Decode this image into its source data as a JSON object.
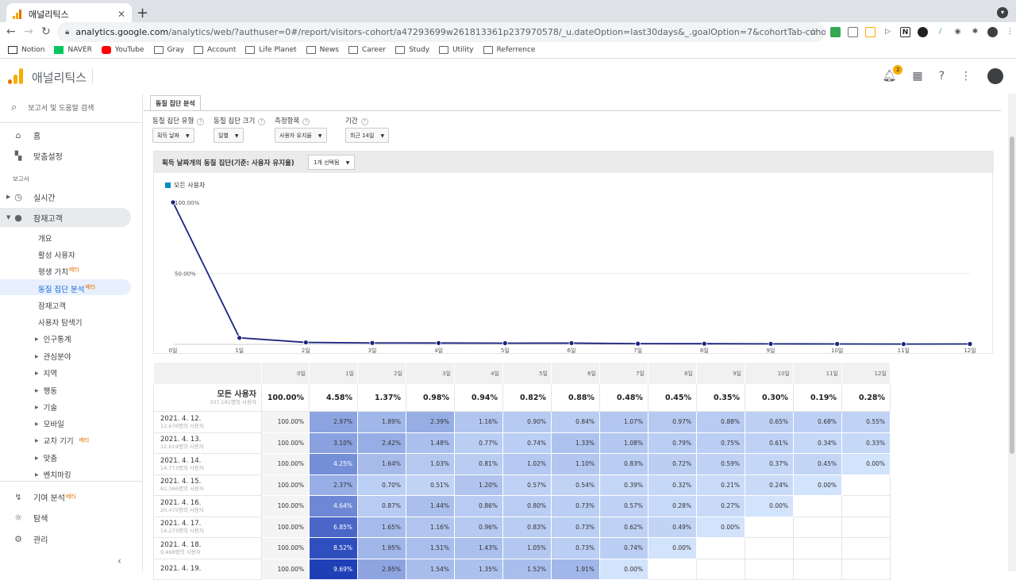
{
  "browser": {
    "tab_title": "애널리틱스",
    "tab_close": "✕",
    "url_host": "analytics.google.com",
    "url_path": "/analytics/web/?authuser=0#/report/visitors-cohort/a47293699w261813361p237970578/_u.dateOption=last30days&_.goalOption=7&cohortTab-cohortOption.cohortBaseDate=202104...",
    "bookmarks": [
      "Notion",
      "NAVER",
      "YouTube",
      "Gray",
      "Account",
      "Life Planet",
      "News",
      "Career",
      "Study",
      "Utility",
      "Referrence"
    ]
  },
  "header": {
    "title": "애널리틱스",
    "notification_count": "2"
  },
  "sidebar": {
    "search_placeholder": "보고서 및 도움말 검색",
    "home": "홈",
    "customization": "맞춤설정",
    "reports_label": "보고서",
    "realtime": "실시간",
    "audience": "잠재고객",
    "audience_sub": [
      "개요",
      "활성 사용자",
      "평생 가치",
      "동질 집단 분석",
      "잠재고객",
      "사용자 탐색기"
    ],
    "beta_label": "베타",
    "audience_groups": [
      "인구통계",
      "관심분야",
      "지역",
      "행동",
      "기술",
      "모바일",
      "교차 기기",
      "맞춤",
      "벤치마킹"
    ],
    "attribution": "기여 분석",
    "discover": "탐색",
    "admin": "관리",
    "collapse": "‹"
  },
  "report": {
    "tab": "동질 집단 분석",
    "filters": [
      {
        "label": "동질 집단 유형",
        "value": "획득 날짜"
      },
      {
        "label": "동질 집단 크기",
        "value": "일별"
      },
      {
        "label": "측정항목",
        "value": "사용자 유지율"
      },
      {
        "label": "기간",
        "value": "최근 14일"
      }
    ],
    "chart_header": "획득 날짜개의 동질 집단(기준: 사용자 유지율)",
    "chart_select": "1개 선택됨"
  },
  "chart_data": {
    "type": "line",
    "series": [
      {
        "name": "모든 사용자",
        "values": [
          100.0,
          4.58,
          1.37,
          0.98,
          0.94,
          0.82,
          0.88,
          0.48,
          0.45,
          0.35,
          0.3,
          0.19,
          0.28
        ]
      }
    ],
    "categories": [
      "0일",
      "1일",
      "2일",
      "3일",
      "4일",
      "5일",
      "6일",
      "7일",
      "8일",
      "9일",
      "10일",
      "11일",
      "12일"
    ],
    "y_ticks": [
      "100.00%",
      "50.00%"
    ],
    "ylim": [
      0,
      100
    ],
    "color": "#1a237e"
  },
  "table": {
    "columns": [
      "0일",
      "1일",
      "2일",
      "3일",
      "4일",
      "5일",
      "6일",
      "7일",
      "8일",
      "9일",
      "10일",
      "11일",
      "12일"
    ],
    "total": {
      "label": "모든 사용자",
      "sub": "337,181명의 사용자",
      "values": [
        "100.00%",
        "4.58%",
        "1.37%",
        "0.98%",
        "0.94%",
        "0.82%",
        "0.88%",
        "0.48%",
        "0.45%",
        "0.35%",
        "0.30%",
        "0.19%",
        "0.28%"
      ]
    },
    "rows": [
      {
        "date": "2021. 4. 12.",
        "sub": "12,676명의 사용자",
        "values": [
          "100.00%",
          "2.97%",
          "1.89%",
          "2.39%",
          "1.16%",
          "0.90%",
          "0.84%",
          "1.07%",
          "0.97%",
          "0.88%",
          "0.65%",
          "0.68%",
          "0.55%"
        ]
      },
      {
        "date": "2021. 4. 13.",
        "sub": "12,619명의 사용자",
        "values": [
          "100.00%",
          "3.10%",
          "2.42%",
          "1.48%",
          "0.77%",
          "0.74%",
          "1.33%",
          "1.08%",
          "0.79%",
          "0.75%",
          "0.61%",
          "0.34%",
          "0.33%"
        ]
      },
      {
        "date": "2021. 4. 14.",
        "sub": "14,773명의 사용자",
        "values": [
          "100.00%",
          "4.25%",
          "1.64%",
          "1.03%",
          "0.81%",
          "1.02%",
          "1.10%",
          "0.83%",
          "0.72%",
          "0.59%",
          "0.37%",
          "0.45%",
          "0.00%"
        ]
      },
      {
        "date": "2021. 4. 15.",
        "sub": "62,366명의 사용자",
        "values": [
          "100.00%",
          "2.37%",
          "0.70%",
          "0.51%",
          "1.20%",
          "0.57%",
          "0.54%",
          "0.39%",
          "0.32%",
          "0.21%",
          "0.24%",
          "0.00%",
          ""
        ]
      },
      {
        "date": "2021. 4. 16.",
        "sub": "20,475명의 사용자",
        "values": [
          "100.00%",
          "4.64%",
          "0.87%",
          "1.44%",
          "0.86%",
          "0.80%",
          "0.73%",
          "0.57%",
          "0.28%",
          "0.27%",
          "0.00%",
          "",
          ""
        ]
      },
      {
        "date": "2021. 4. 17.",
        "sub": "14,273명의 사용자",
        "values": [
          "100.00%",
          "6.85%",
          "1.65%",
          "1.16%",
          "0.96%",
          "0.83%",
          "0.73%",
          "0.62%",
          "0.49%",
          "0.00%",
          "",
          "",
          ""
        ]
      },
      {
        "date": "2021. 4. 18.",
        "sub": "9,468명의 사용자",
        "values": [
          "100.00%",
          "8.52%",
          "1.95%",
          "1.51%",
          "1.43%",
          "1.05%",
          "0.73%",
          "0.74%",
          "0.00%",
          "",
          "",
          "",
          ""
        ]
      },
      {
        "date": "2021. 4. 19.",
        "sub": "",
        "values": [
          "100.00%",
          "9.69%",
          "2.95%",
          "1.54%",
          "1.35%",
          "1.52%",
          "1.91%",
          "0.00%",
          "",
          "",
          "",
          "",
          ""
        ]
      }
    ]
  }
}
